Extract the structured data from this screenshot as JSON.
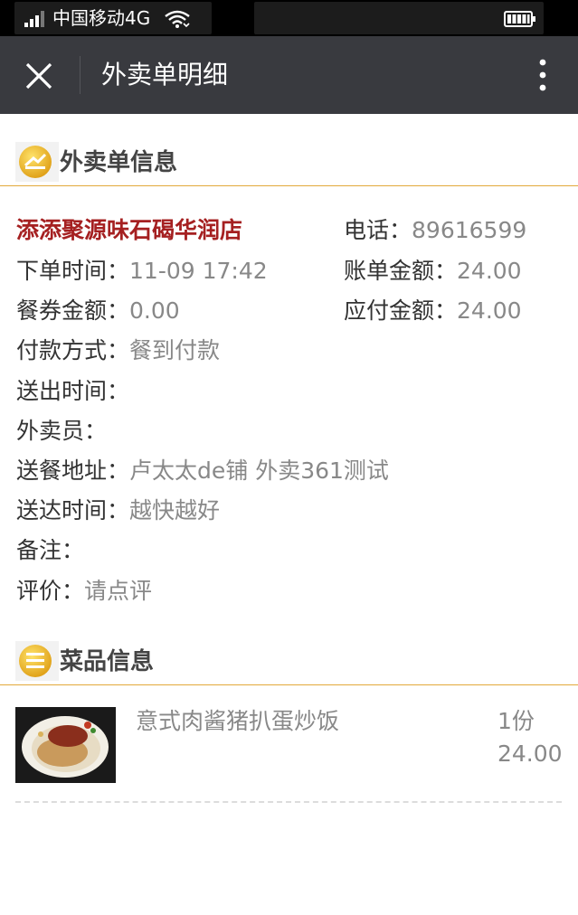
{
  "status_bar": {
    "carrier": "中国移动4G",
    "icons": [
      "signal-icon",
      "wifi-icon",
      "battery-icon"
    ]
  },
  "nav": {
    "title": "外卖单明细",
    "close_icon": "close-icon",
    "more_icon": "more-vertical-icon"
  },
  "order_section": {
    "title": "外卖单信息",
    "shop_name": "添添聚源味石碣华润店",
    "phone": {
      "label": "电话：",
      "value": "89616599"
    },
    "order_time": {
      "label": "下单时间：",
      "value": "11-09 17:42"
    },
    "bill_amount": {
      "label": "账单金额：",
      "value": "24.00"
    },
    "coupon_amount": {
      "label": "餐券金额：",
      "value": "0.00"
    },
    "payable_amount": {
      "label": "应付金额：",
      "value": "24.00"
    },
    "payment_method": {
      "label": "付款方式：",
      "value": "餐到付款"
    },
    "dispatch_time": {
      "label": "送出时间：",
      "value": ""
    },
    "courier": {
      "label": "外卖员：",
      "value": ""
    },
    "address": {
      "label": "送餐地址：",
      "value": "卢太太de铺 外卖361测试"
    },
    "arrival_time": {
      "label": "送达时间：",
      "value": "越快越好"
    },
    "remark": {
      "label": "备注：",
      "value": ""
    },
    "review": {
      "label": "评价：",
      "value": "请点评"
    }
  },
  "dish_section": {
    "title": "菜品信息",
    "items": [
      {
        "name": "意式肉酱猪扒蛋炒饭",
        "qty": "1份",
        "price": "24.00"
      }
    ]
  },
  "colors": {
    "nav_bg": "#393a3f",
    "accent_line": "#e2a93b",
    "shop_name": "#a52021",
    "value_text": "#888888"
  }
}
